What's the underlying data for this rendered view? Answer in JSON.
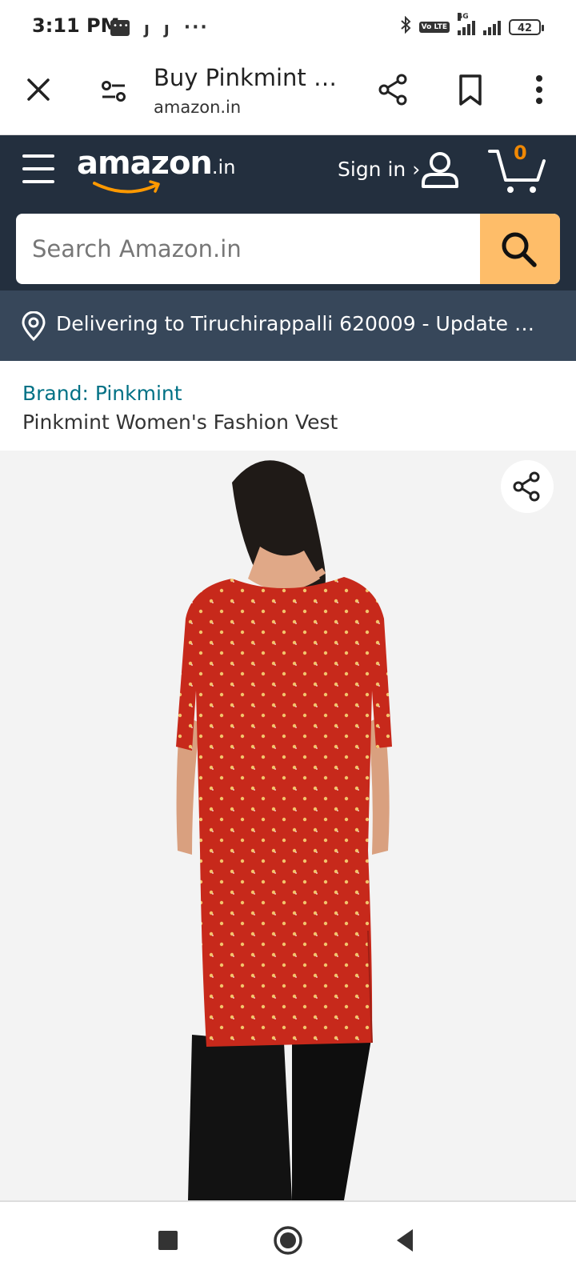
{
  "status_bar": {
    "time": "3:11 PM",
    "notification_icons": [
      "message-icon",
      "jio-icon",
      "jio-icon",
      "more-dots-icon"
    ],
    "right_icons": [
      "bluetooth-icon",
      "volte-icon",
      "signal-4g-icon",
      "signal-icon",
      "battery-icon"
    ],
    "volte_label": "Vo LTE",
    "network_type": "4G",
    "battery_level": "42"
  },
  "browser_toolbar": {
    "title": "Buy Pinkmint W...",
    "url": "amazon.in"
  },
  "amazon_header": {
    "logo_text": "amazon",
    "logo_tld": ".in",
    "signin_label": "Sign in ›",
    "cart_count": "0",
    "search_placeholder": "Search Amazon.in",
    "search_value": ""
  },
  "delivery": {
    "text": "Delivering to Tiruchirappalli 620009 - Update l..."
  },
  "product": {
    "brand": "Brand: Pinkmint",
    "title": "Pinkmint Women's Fashion Vest"
  },
  "colors": {
    "header_bg": "#232f3e",
    "delivery_bg": "#37475a",
    "search_button": "#febd69",
    "cart_count": "#f08804",
    "link": "#007185",
    "kurta_red": "#c7291b"
  }
}
